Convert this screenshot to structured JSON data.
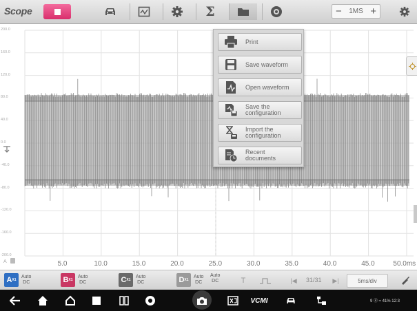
{
  "app": {
    "title": "Scope"
  },
  "toolbar": {
    "timebase": {
      "minus": "−",
      "value": "1MS",
      "plus": "+"
    },
    "icons": [
      "stop-icon",
      "car-icon",
      "waveform-library-icon",
      "settings-gear-icon",
      "sigma-math-icon",
      "folder-icon",
      "help-icon",
      "scope-settings-gear-icon"
    ]
  },
  "menu": {
    "items": [
      {
        "label": "Print",
        "icon": "printer-icon"
      },
      {
        "label": "Save waveform",
        "icon": "save-icon"
      },
      {
        "label": "Open waveform",
        "icon": "open-waveform-icon"
      },
      {
        "label": "Save the\nconfiguration",
        "icon": "save-config-icon"
      },
      {
        "label": "Import the\nconfiguration",
        "icon": "import-config-icon"
      },
      {
        "label": "Recent\ndocuments",
        "icon": "recent-docs-icon"
      }
    ]
  },
  "plot": {
    "y_ticks": [
      "200.0",
      "160.0",
      "120.0",
      "80.0",
      "40.0",
      "0.0",
      "-40.0",
      "-80.0",
      "-120.0",
      "-160.0",
      "-200.0"
    ],
    "x_ticks": [
      "5.0",
      "10.0",
      "15.0",
      "20.0",
      "25.0",
      "30.0",
      "35.0",
      "40.0",
      "45.0",
      "50.0"
    ],
    "x_unit": "ms",
    "x_origin": "A",
    "colors": {
      "signal": "#8c8c8c",
      "grid": "#e2e2e2"
    }
  },
  "channels": [
    {
      "letter": "A",
      "sub": "X1",
      "mode": "Auto\nDC",
      "color": "#2f6fc3"
    },
    {
      "letter": "B",
      "sub": "X1",
      "mode": "Auto\nDC",
      "color": "#c93763"
    },
    {
      "letter": "C",
      "sub": "X1",
      "mode": "Auto\nDC",
      "color": "#6a6a6a"
    },
    {
      "letter": "D",
      "sub": "X1",
      "mode": "Auto\nDC",
      "color": "#9a9a9a"
    }
  ],
  "bottom": {
    "extra_mode": "Auto\nDC",
    "page_indicator": "31/31",
    "time_div": "5ms/div"
  },
  "android": {
    "vcm_label": "VCMI",
    "status": "9 ⓓ ≈ 41% 12:3"
  }
}
